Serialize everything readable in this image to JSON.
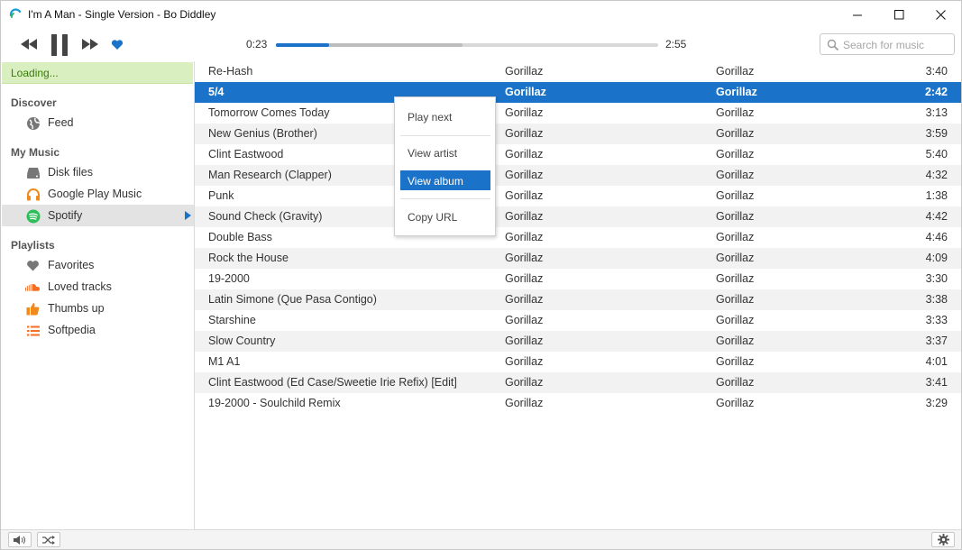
{
  "window": {
    "title": "I'm A Man - Single Version - Bo Diddley",
    "accent_color": "#1a73c8"
  },
  "player": {
    "current_time": "0:23",
    "total_time": "2:55",
    "progress_fraction": 0.138,
    "buffered_fraction": 0.488,
    "liked": true
  },
  "search": {
    "placeholder": "Search for music",
    "value": ""
  },
  "sidebar": {
    "loading_text": "Loading...",
    "discover_heading": "Discover",
    "feed_label": "Feed",
    "mymusic_heading": "My Music",
    "disk_label": "Disk files",
    "gpm_label": "Google Play Music",
    "spotify_label": "Spotify",
    "playlists_heading": "Playlists",
    "favorites_label": "Favorites",
    "loved_label": "Loved tracks",
    "thumbs_label": "Thumbs up",
    "softpedia_label": "Softpedia",
    "active_item": "Spotify"
  },
  "tracks": [
    {
      "title": "Re-Hash",
      "artist": "Gorillaz",
      "album": "Gorillaz",
      "duration": "3:40"
    },
    {
      "title": "5/4",
      "artist": "Gorillaz",
      "album": "Gorillaz",
      "duration": "2:42"
    },
    {
      "title": "Tomorrow Comes Today",
      "artist": "Gorillaz",
      "album": "Gorillaz",
      "duration": "3:13"
    },
    {
      "title": "New Genius (Brother)",
      "artist": "Gorillaz",
      "album": "Gorillaz",
      "duration": "3:59"
    },
    {
      "title": "Clint Eastwood",
      "artist": "Gorillaz",
      "album": "Gorillaz",
      "duration": "5:40"
    },
    {
      "title": "Man Research (Clapper)",
      "artist": "Gorillaz",
      "album": "Gorillaz",
      "duration": "4:32"
    },
    {
      "title": "Punk",
      "artist": "Gorillaz",
      "album": "Gorillaz",
      "duration": "1:38"
    },
    {
      "title": "Sound Check (Gravity)",
      "artist": "Gorillaz",
      "album": "Gorillaz",
      "duration": "4:42"
    },
    {
      "title": "Double Bass",
      "artist": "Gorillaz",
      "album": "Gorillaz",
      "duration": "4:46"
    },
    {
      "title": "Rock the House",
      "artist": "Gorillaz",
      "album": "Gorillaz",
      "duration": "4:09"
    },
    {
      "title": "19-2000",
      "artist": "Gorillaz",
      "album": "Gorillaz",
      "duration": "3:30"
    },
    {
      "title": "Latin Simone (Que Pasa Contigo)",
      "artist": "Gorillaz",
      "album": "Gorillaz",
      "duration": "3:38"
    },
    {
      "title": "Starshine",
      "artist": "Gorillaz",
      "album": "Gorillaz",
      "duration": "3:33"
    },
    {
      "title": "Slow Country",
      "artist": "Gorillaz",
      "album": "Gorillaz",
      "duration": "3:37"
    },
    {
      "title": "M1 A1",
      "artist": "Gorillaz",
      "album": "Gorillaz",
      "duration": "4:01"
    },
    {
      "title": "Clint Eastwood (Ed Case/Sweetie Irie Refix) [Edit]",
      "artist": "Gorillaz",
      "album": "Gorillaz",
      "duration": "3:41"
    },
    {
      "title": "19-2000 - Soulchild Remix",
      "artist": "Gorillaz",
      "album": "Gorillaz",
      "duration": "3:29"
    }
  ],
  "selected_track": "5/4",
  "context_menu": {
    "play_next": "Play next",
    "view_artist": "View artist",
    "view_album": "View album",
    "copy_url": "Copy URL",
    "highlighted": "View album"
  },
  "icons": {
    "app": "lastfm-swirl-icon",
    "prev": "rewind-icon",
    "pause": "pause-icon",
    "next": "fast-forward-icon",
    "like": "heart-icon",
    "search": "search-icon",
    "volume": "speaker-icon",
    "shuffle": "shuffle-icon",
    "settings": "gear-icon"
  }
}
